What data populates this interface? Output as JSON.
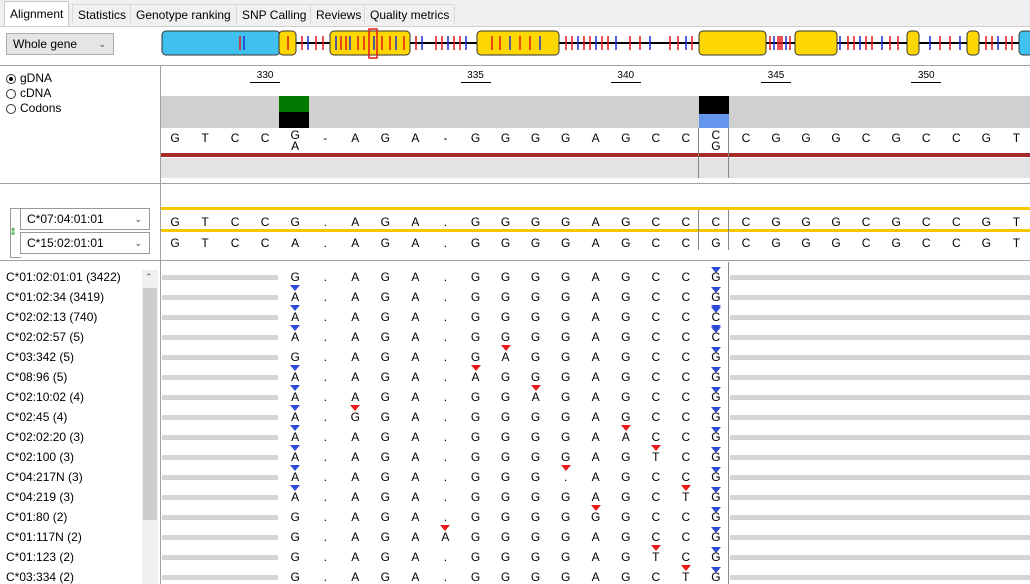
{
  "tabs": [
    {
      "label": "Alignment",
      "active": true
    },
    {
      "label": "Statistics",
      "active": false
    },
    {
      "label": "Genotype ranking",
      "active": false
    },
    {
      "label": "SNP Calling",
      "active": false
    },
    {
      "label": "Reviews",
      "active": false
    },
    {
      "label": "Quality metrics",
      "active": false
    }
  ],
  "region_select": {
    "value": "Whole gene"
  },
  "view_mode": {
    "options": [
      "gDNA",
      "cDNA",
      "Codons"
    ],
    "selected": "gDNA"
  },
  "ruler_ticks": [
    "330",
    "335",
    "340",
    "345",
    "350"
  ],
  "reference": {
    "bases": [
      "G",
      "T",
      "C",
      "C",
      "G",
      "-",
      "A",
      "G",
      "A",
      "-",
      "G",
      "G",
      "G",
      "G",
      "A",
      "G",
      "C",
      "C",
      "C",
      "C",
      "G",
      "G",
      "G",
      "C",
      "G",
      "C",
      "C",
      "G",
      "T"
    ],
    "alt_bases": {
      "4": "A",
      "18": "G"
    }
  },
  "alleles": [
    {
      "name": "C*07:04:01:01",
      "bases": [
        "G",
        "T",
        "C",
        "C",
        "G",
        ".",
        "A",
        "G",
        "A",
        ".",
        "G",
        "G",
        "G",
        "G",
        "A",
        "G",
        "C",
        "C",
        "C",
        "C",
        "G",
        "G",
        "G",
        "C",
        "G",
        "C",
        "C",
        "G",
        "T"
      ]
    },
    {
      "name": "C*15:02:01:01",
      "bases": [
        "G",
        "T",
        "C",
        "C",
        "A",
        ".",
        "A",
        "G",
        "A",
        ".",
        "G",
        "G",
        "G",
        "G",
        "A",
        "G",
        "C",
        "C",
        "G",
        "C",
        "G",
        "G",
        "G",
        "C",
        "G",
        "C",
        "C",
        "G",
        "T"
      ]
    }
  ],
  "candidates": [
    {
      "label": "C*01:02:01:01 (3422)",
      "bases": [
        "G",
        ".",
        "A",
        "G",
        "A",
        ".",
        "G",
        "G",
        "G",
        "G",
        "A",
        "G",
        "C",
        "C",
        "G"
      ]
    },
    {
      "label": "C*01:02:34 (3419)",
      "bases": [
        "A",
        ".",
        "A",
        "G",
        "A",
        ".",
        "G",
        "G",
        "G",
        "G",
        "A",
        "G",
        "C",
        "C",
        "G"
      ]
    },
    {
      "label": "C*02:02:13 (740)",
      "bases": [
        "A",
        ".",
        "A",
        "G",
        "A",
        ".",
        "G",
        "G",
        "G",
        "G",
        "A",
        "G",
        "C",
        "C",
        "C"
      ]
    },
    {
      "label": "C*02:02:57 (5)",
      "bases": [
        "A",
        ".",
        "A",
        "G",
        "A",
        ".",
        "G",
        "G",
        "G",
        "G",
        "A",
        "G",
        "C",
        "C",
        "C"
      ]
    },
    {
      "label": "C*03:342 (5)",
      "bases": [
        "G",
        ".",
        "A",
        "G",
        "A",
        ".",
        "G",
        "A",
        "G",
        "G",
        "A",
        "G",
        "C",
        "C",
        "G"
      ]
    },
    {
      "label": "C*08:96 (5)",
      "bases": [
        "A",
        ".",
        "A",
        "G",
        "A",
        ".",
        "A",
        "G",
        "G",
        "G",
        "A",
        "G",
        "C",
        "C",
        "G"
      ]
    },
    {
      "label": "C*02:10:02 (4)",
      "bases": [
        "A",
        ".",
        "A",
        "G",
        "A",
        ".",
        "G",
        "G",
        "A",
        "G",
        "A",
        "G",
        "C",
        "C",
        "G"
      ]
    },
    {
      "label": "C*02:45 (4)",
      "bases": [
        "A",
        ".",
        "G",
        "G",
        "A",
        ".",
        "G",
        "G",
        "G",
        "G",
        "A",
        "G",
        "C",
        "C",
        "G"
      ]
    },
    {
      "label": "C*02:02:20 (3)",
      "bases": [
        "A",
        ".",
        "A",
        "G",
        "A",
        ".",
        "G",
        "G",
        "G",
        "G",
        "A",
        "A",
        "C",
        "C",
        "G"
      ]
    },
    {
      "label": "C*02:100 (3)",
      "bases": [
        "A",
        ".",
        "A",
        "G",
        "A",
        ".",
        "G",
        "G",
        "G",
        "G",
        "A",
        "G",
        "T",
        "C",
        "G"
      ]
    },
    {
      "label": "C*04:217N (3)",
      "bases": [
        "A",
        ".",
        "A",
        "G",
        "A",
        ".",
        "G",
        "G",
        "G",
        ".",
        "A",
        "G",
        "C",
        "C",
        "G"
      ]
    },
    {
      "label": "C*04:219 (3)",
      "bases": [
        "A",
        ".",
        "A",
        "G",
        "A",
        ".",
        "G",
        "G",
        "G",
        "G",
        "A",
        "G",
        "C",
        "T",
        "G"
      ]
    },
    {
      "label": "C*01:80 (2)",
      "bases": [
        "G",
        ".",
        "A",
        "G",
        "A",
        ".",
        "G",
        "G",
        "G",
        "G",
        "G",
        "G",
        "C",
        "C",
        "G"
      ]
    },
    {
      "label": "C*01:117N (2)",
      "bases": [
        "G",
        ".",
        "A",
        "G",
        "A",
        "A",
        "G",
        "G",
        "G",
        "G",
        "A",
        "G",
        "C",
        "C",
        "G"
      ]
    },
    {
      "label": "C*01:123 (2)",
      "bases": [
        "G",
        ".",
        "A",
        "G",
        "A",
        ".",
        "G",
        "G",
        "G",
        "G",
        "A",
        "G",
        "T",
        "C",
        "G"
      ]
    },
    {
      "label": "C*03:334 (2)",
      "bases": [
        "G",
        ".",
        "A",
        "G",
        "A",
        ".",
        "G",
        "G",
        "G",
        "G",
        "A",
        "G",
        "C",
        "T",
        "G"
      ]
    }
  ],
  "colors": {
    "exon": "#ffd700",
    "utr": "#40c0ee",
    "reference_bar": "#a52a2a",
    "allele_line": "#f5c800",
    "mismatch_red": "#e81919",
    "mismatch_blue": "#2a4bd7",
    "quality_green": "#007a00",
    "quality_blue": "#6495ed"
  }
}
